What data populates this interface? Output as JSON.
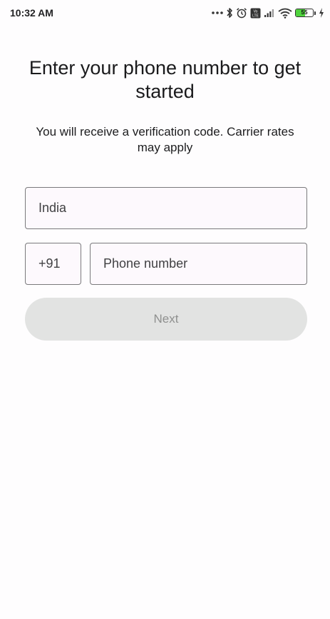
{
  "status_bar": {
    "time": "10:32 AM",
    "battery_percent": "55",
    "battery_level": 0.55,
    "icons": [
      "more-dots-icon",
      "bluetooth-icon",
      "alarm-icon",
      "volte-icon",
      "signal-icon",
      "wifi-icon",
      "battery-icon",
      "charging-bolt-icon"
    ]
  },
  "page": {
    "title": "Enter your phone number to get started",
    "subtitle": "You will receive a verification code. Carrier rates may apply"
  },
  "form": {
    "country_value": "India",
    "country_code": "+91",
    "phone_placeholder": "Phone number",
    "next_label": "Next"
  },
  "colors": {
    "background": "#fefdfe",
    "field_border": "#7a7a7c",
    "button_disabled_bg": "#e2e3e2",
    "button_disabled_text": "#8f908f",
    "battery_fill": "#4fd33d"
  }
}
